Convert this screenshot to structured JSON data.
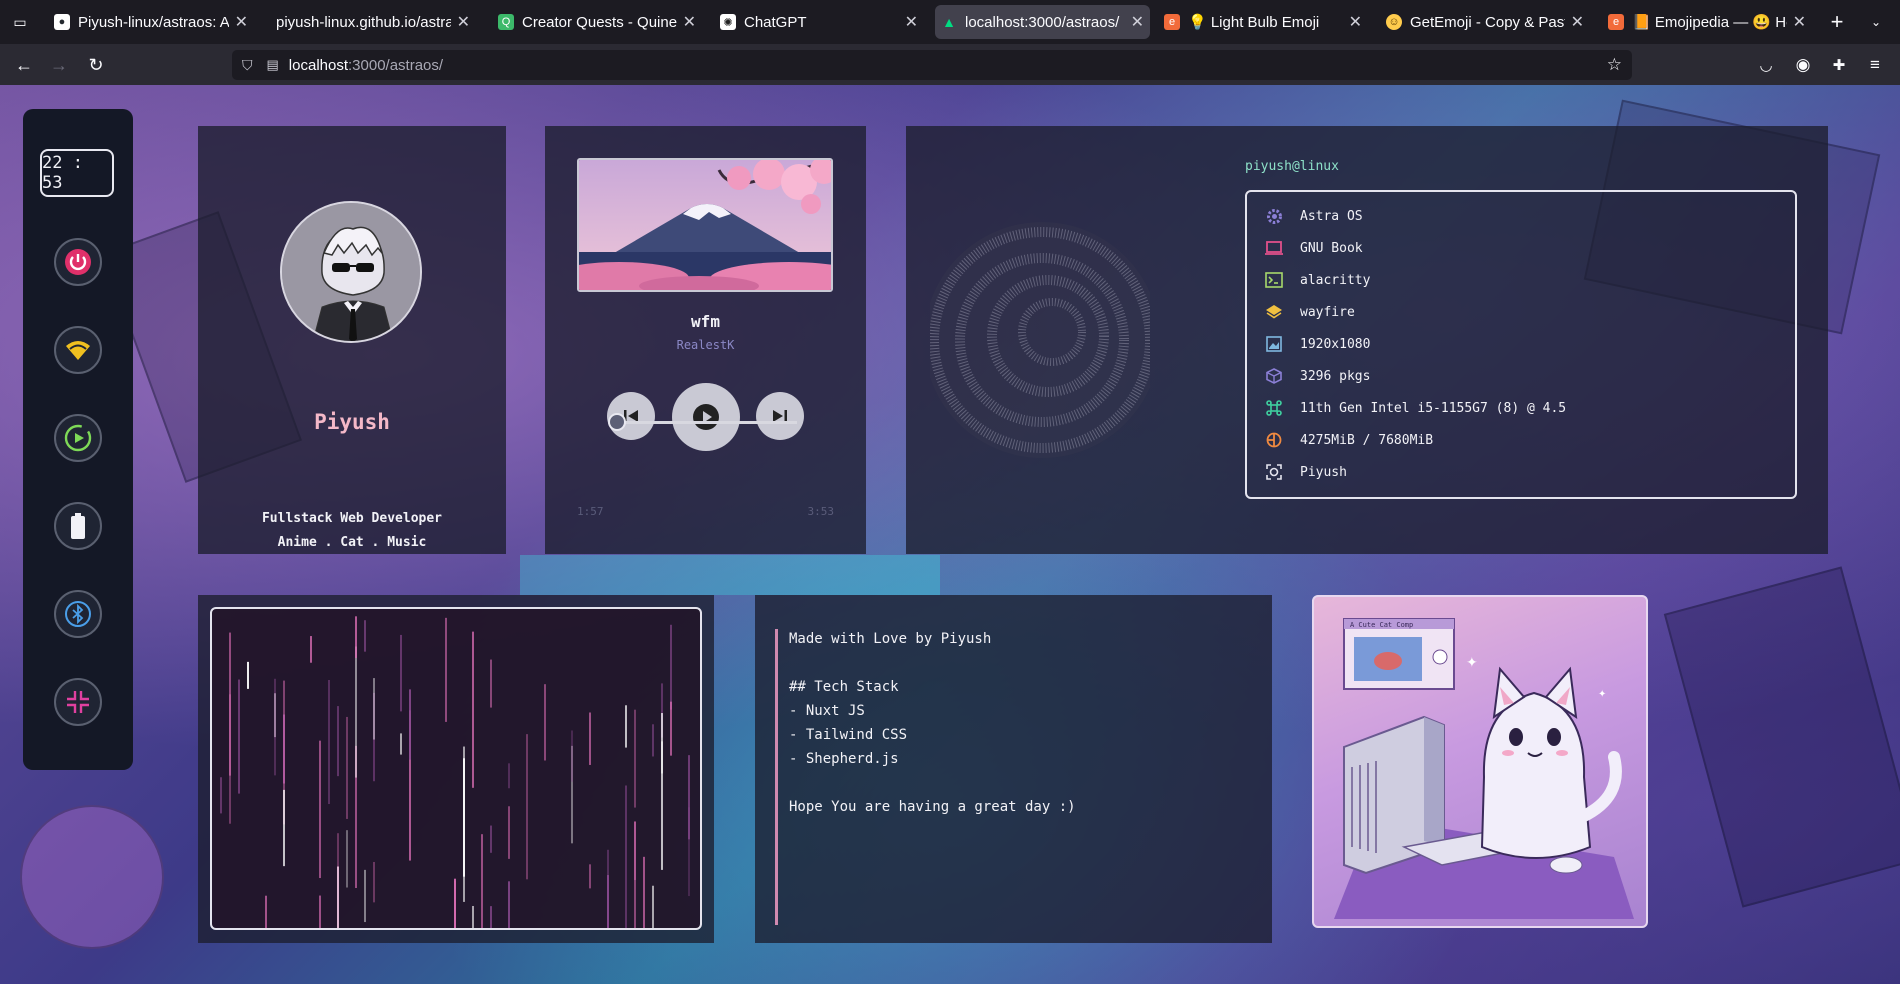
{
  "browser": {
    "tabs": [
      {
        "title": "Piyush-linux/astraos: An Web",
        "icon": "github-icon",
        "color": "#24292f"
      },
      {
        "title": "piyush-linux.github.io/astraos/",
        "icon": "",
        "color": ""
      },
      {
        "title": "Creator Quests - Quine",
        "icon": "quine-icon",
        "color": "#3cb96a"
      },
      {
        "title": "ChatGPT",
        "icon": "chatgpt-icon",
        "color": "#ffffff"
      },
      {
        "title": "localhost:3000/astraos/",
        "icon": "nuxt-icon",
        "color": "#00dc82"
      },
      {
        "title": "💡 Light Bulb Emoji",
        "icon": "emojipedia-icon",
        "color": "#f26b3a"
      },
      {
        "title": "GetEmoji - Copy & Paste All E",
        "icon": "smile-emoji-icon",
        "color": "#ffcc4d"
      },
      {
        "title": "📙 Emojipedia — 😃 Home of",
        "icon": "emojipedia-icon",
        "color": "#f26b3a"
      }
    ],
    "active_tab": 4,
    "url_host": "localhost",
    "url_rest": ":3000/astraos/"
  },
  "dock": {
    "time": "22 : 53",
    "buttons": [
      "power-icon",
      "wifi-icon",
      "play-circle-icon",
      "battery-icon",
      "bluetooth-icon",
      "settings-icon"
    ]
  },
  "profile": {
    "name": "Piyush",
    "line1": "Fullstack Web Developer",
    "line2": "Anime . Cat . Music"
  },
  "music": {
    "song": "wfm",
    "artist": "RealestK",
    "elapsed": "1:57",
    "duration": "3:53",
    "progress": 0.0
  },
  "fetch": {
    "user": "piyush@linux",
    "rows": [
      {
        "icon": "gear-icon",
        "text": "Astra OS",
        "color": "#8b7fd6"
      },
      {
        "icon": "laptop-icon",
        "text": "GNU Book",
        "color": "#e0508a"
      },
      {
        "icon": "terminal-icon",
        "text": "alacritty",
        "color": "#a6d86a"
      },
      {
        "icon": "layers-icon",
        "text": "wayfire",
        "color": "#f0c040"
      },
      {
        "icon": "image-icon",
        "text": "1920x1080",
        "color": "#7fb8e0"
      },
      {
        "icon": "package-icon",
        "text": "3296 pkgs",
        "color": "#8b7fd6"
      },
      {
        "icon": "cpu-icon",
        "text": "11th Gen Intel i5-1155G7 (8) @ 4.5",
        "color": "#3fd0a0"
      },
      {
        "icon": "memory-icon",
        "text": "4275MiB / 7680MiB",
        "color": "#f08a40"
      },
      {
        "icon": "face-icon",
        "text": "Piyush",
        "color": "#e4e4ee"
      }
    ]
  },
  "notes": {
    "lines": [
      "Made with Love by Piyush",
      "",
      "## Tech Stack",
      "- Nuxt JS",
      "- Tailwind CSS",
      "- Shepherd.js",
      "",
      "Hope You are having a great day :)"
    ]
  },
  "cat": {
    "window_title": "A Cute Cat Comp"
  }
}
